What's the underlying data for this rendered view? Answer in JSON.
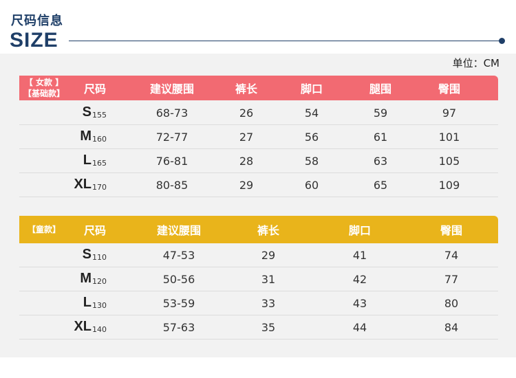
{
  "header": {
    "title_cn": "尺码信息",
    "title_en": "SIZE",
    "unit": "单位：CM"
  },
  "women": {
    "tag_line1": "【 女款 】",
    "tag_line2": "【基础款】",
    "columns": [
      "尺码",
      "建议腰围",
      "裤长",
      "脚口",
      "腿围",
      "臀围"
    ],
    "rows": [
      {
        "size": "S",
        "height": "155",
        "waist": "68-73",
        "length": "26",
        "hem": "54",
        "thigh": "59",
        "hip": "97"
      },
      {
        "size": "M",
        "height": "160",
        "waist": "72-77",
        "length": "27",
        "hem": "56",
        "thigh": "61",
        "hip": "101"
      },
      {
        "size": "L",
        "height": "165",
        "waist": "76-81",
        "length": "28",
        "hem": "58",
        "thigh": "63",
        "hip": "105"
      },
      {
        "size": "XL",
        "height": "170",
        "waist": "80-85",
        "length": "29",
        "hem": "60",
        "thigh": "65",
        "hip": "109"
      }
    ]
  },
  "kids": {
    "tag": "【童款】",
    "columns": [
      "尺码",
      "建议腰围",
      "裤长",
      "脚口",
      "臀围"
    ],
    "rows": [
      {
        "size": "S",
        "height": "110",
        "waist": "47-53",
        "length": "29",
        "hem": "41",
        "hip": "74"
      },
      {
        "size": "M",
        "height": "120",
        "waist": "50-56",
        "length": "31",
        "hem": "42",
        "hip": "77"
      },
      {
        "size": "L",
        "height": "130",
        "waist": "53-59",
        "length": "33",
        "hem": "43",
        "hip": "80"
      },
      {
        "size": "XL",
        "height": "140",
        "waist": "57-63",
        "length": "35",
        "hem": "44",
        "hip": "84"
      }
    ]
  },
  "colors": {
    "title": "#1f3f68",
    "women_header": "#f26a72",
    "kids_header": "#e9b41b"
  }
}
